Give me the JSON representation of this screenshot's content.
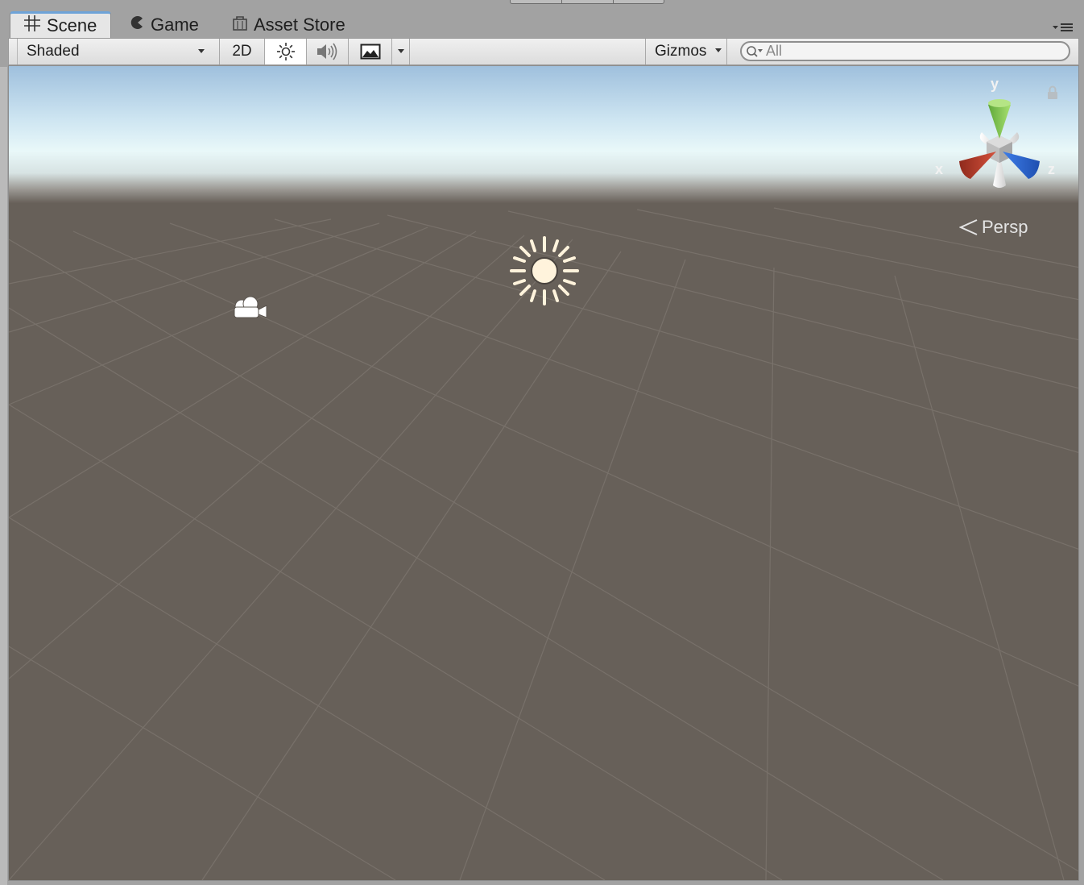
{
  "tabs": {
    "scene": {
      "label": "Scene",
      "icon": "grid-icon",
      "active": true
    },
    "game": {
      "label": "Game",
      "icon": "pacman-icon"
    },
    "asset_store": {
      "label": "Asset Store",
      "icon": "bag-icon"
    }
  },
  "toolbar": {
    "shading_mode": "Shaded",
    "mode_2d": "2D",
    "lighting_icon": "sun-icon",
    "audio_icon": "speaker-icon",
    "effects_icon": "image-icon",
    "gizmos": "Gizmos",
    "search_placeholder": "All"
  },
  "viewport": {
    "projection_label": "Persp",
    "axis_labels": {
      "y": "y",
      "x": "x",
      "z": "z"
    },
    "objects": [
      {
        "name": "Directional Light",
        "icon": "sun-icon"
      },
      {
        "name": "Main Camera",
        "icon": "camera-icon"
      }
    ]
  },
  "colors": {
    "sky_top": "#9fc0dd",
    "horizon": "#e9f8f9",
    "ground": "#676059",
    "axis_y": "#7ac943",
    "axis_x": "#c0392b",
    "axis_z": "#2e6fd8",
    "tab_active_accent": "#6ea3d8"
  }
}
